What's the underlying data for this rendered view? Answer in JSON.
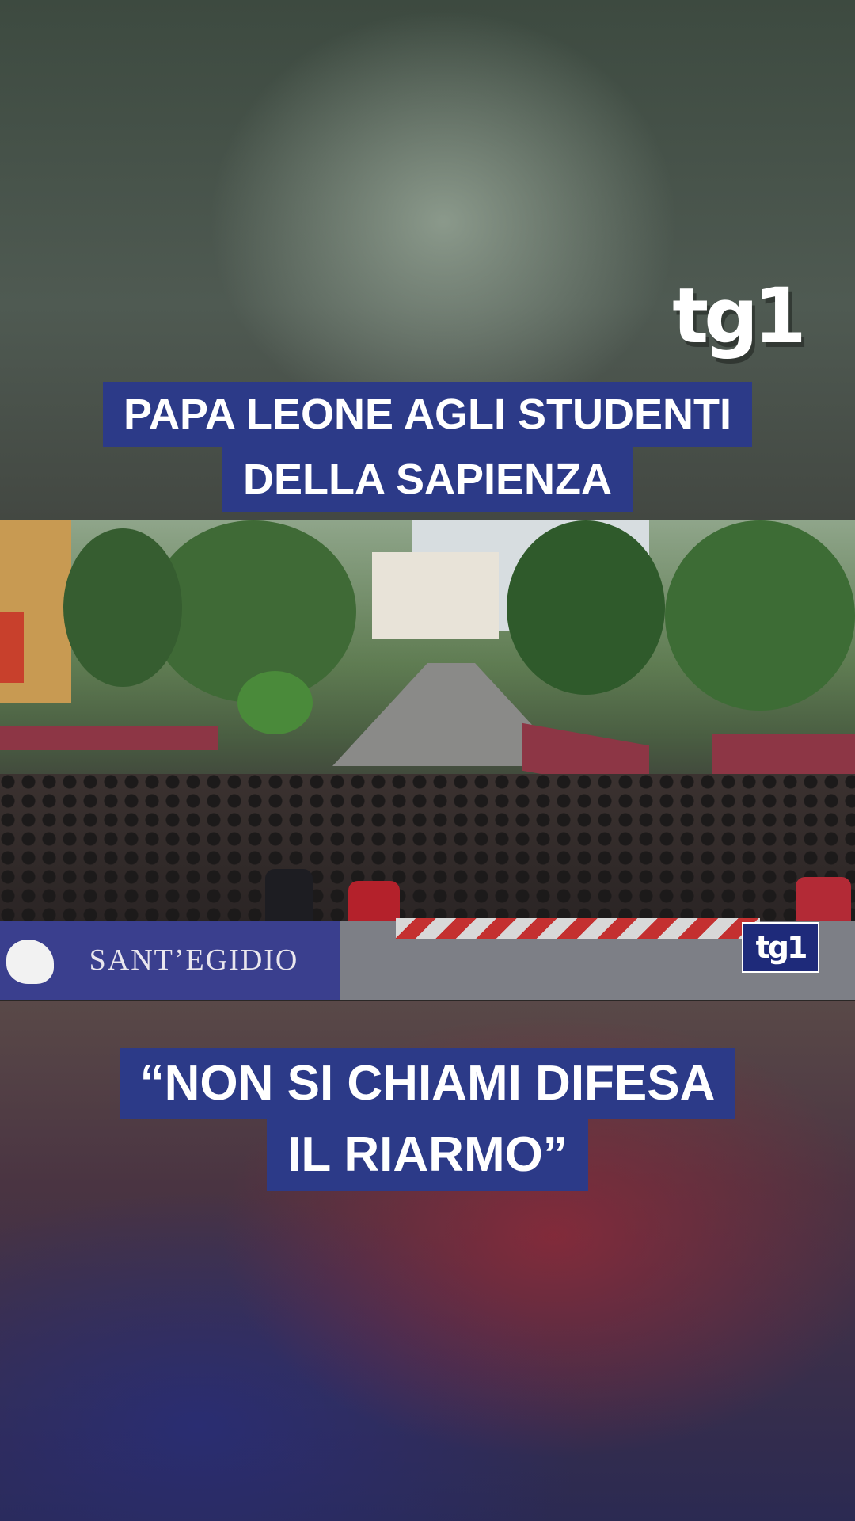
{
  "branding": {
    "logo_top": "tg1",
    "logo_video": "tg1"
  },
  "captions": {
    "top": [
      "PAPA LEONE AGLI STUDENTI",
      "DELLA SAPIENZA"
    ],
    "bottom": [
      "“NON SI CHIAMI DIFESA",
      "IL RIARMO”"
    ]
  },
  "video": {
    "banner_text": "SANT’EGIDIO"
  },
  "colors": {
    "caption_bg": "#2c3a88",
    "caption_text": "#ffffff"
  }
}
